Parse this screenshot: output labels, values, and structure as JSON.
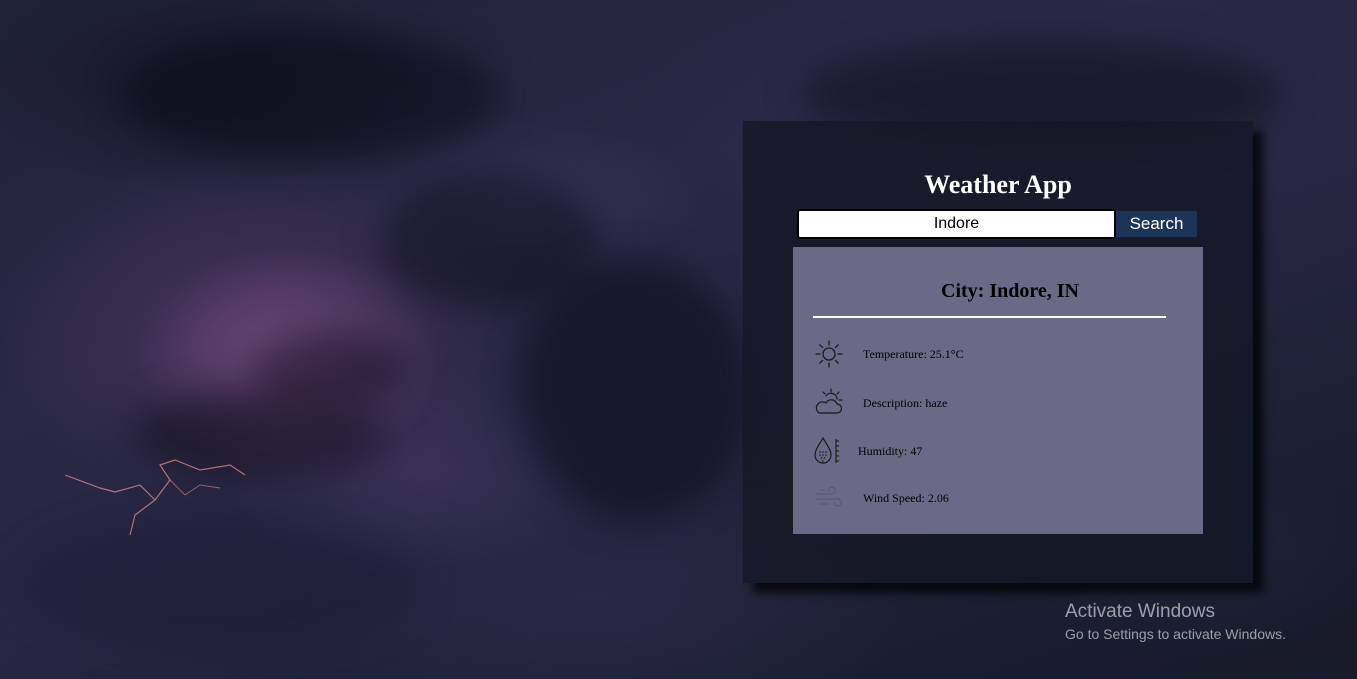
{
  "app": {
    "title": "Weather App"
  },
  "search": {
    "value": "Indore",
    "button_label": "Search"
  },
  "result": {
    "city": "City: Indore, IN",
    "temperature": "Temperature: 25.1°C",
    "description": "Description: haze",
    "humidity": "Humidity: 47",
    "wind_speed": "Wind Speed: 2.06"
  },
  "icons": {
    "temperature": "sun-icon",
    "description": "partly-cloudy-icon",
    "humidity": "humidity-drop-icon",
    "wind_speed": "wind-icon"
  },
  "watermark": {
    "title": "Activate Windows",
    "subtitle": "Go to Settings to activate Windows."
  },
  "colors": {
    "button_bg": "#1c3458",
    "result_panel": "#7e7e9e",
    "card_bg": "#121622"
  }
}
